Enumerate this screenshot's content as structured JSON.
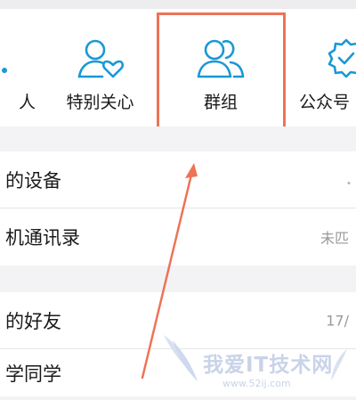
{
  "icon_row": {
    "tiles": [
      {
        "label": "人",
        "icon": "contacts-icon"
      },
      {
        "label": "特别关心",
        "icon": "person-heart-icon"
      },
      {
        "label": "群组",
        "icon": "group-icon"
      },
      {
        "label": "公众号",
        "icon": "verified-badge-icon"
      }
    ]
  },
  "list": {
    "rows": [
      {
        "label": "的设备",
        "meta": ""
      },
      {
        "label": "机通讯录",
        "meta": "未匹"
      },
      {
        "label": "的好友",
        "meta": "17/"
      },
      {
        "label": "学同学",
        "meta": ""
      }
    ]
  },
  "watermark": {
    "title": "我爱IT技术网",
    "url": "www.52ij.com"
  },
  "colors": {
    "accent": "#1a98d5",
    "highlight": "#ee7356",
    "background": "#f4f4f6"
  }
}
